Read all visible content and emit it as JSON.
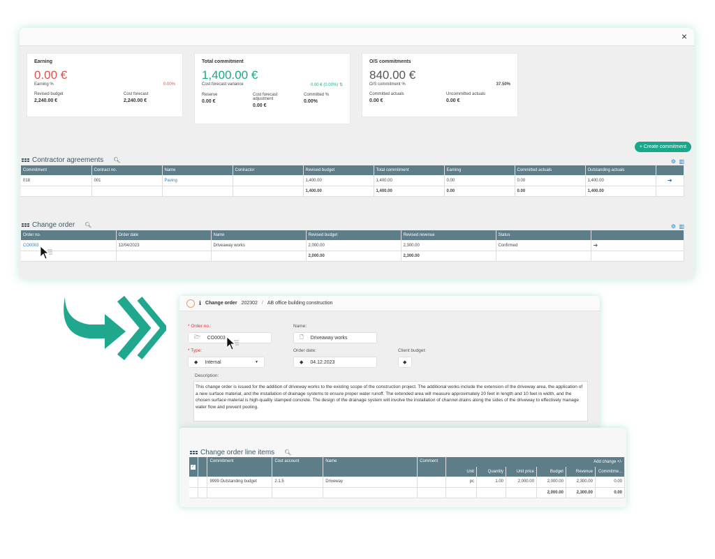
{
  "panel": {
    "close": "×",
    "cards": {
      "earning": {
        "title": "Earning",
        "value": "0.00 €",
        "pct_label": "Earning %",
        "pct": "0.00%",
        "revised_budget_label": "Revised budget",
        "revised_budget": "2,240.00 €",
        "cost_forecast_label": "Cost forecast",
        "cost_forecast": "2,240.00 €"
      },
      "total_commitment": {
        "title": "Total commitment",
        "value": "1,400.00 €",
        "variance_label": "Cost forecast variance",
        "variance": "0.00 € (0.00%) ⇅",
        "reserve_label": "Reserve",
        "reserve": "0.00 €",
        "adj_label_1": "Cost forecast",
        "adj_label_2": "adjustment",
        "adj": "0.00 €",
        "committed_pct_label": "Committed %",
        "committed_pct": "0.00%"
      },
      "os": {
        "title": "O/S commitments",
        "value": "840.00 €",
        "pct_label": "O/S commitment %",
        "pct": "37.50%",
        "committed_actuals_label": "Committed actuals",
        "committed_actuals": "0.00 €",
        "uncommitted_label": "Uncommitted actuals",
        "uncommitted": "0.00 €"
      }
    },
    "create_button": "+ Create commitment",
    "contractor": {
      "title": "Contractor agreements",
      "headers": [
        "Commitment",
        "Contract no.",
        "Name",
        "Contractor",
        "Revised budget",
        "Total commitment",
        "Earning",
        "Committed actuals",
        "Outstanding actuals"
      ],
      "row": [
        "018",
        "001",
        "Paving",
        "",
        "1,400.00",
        "1,400.00",
        "0.00",
        "0.00",
        "1,400.00"
      ],
      "totals": [
        "",
        "",
        "",
        "",
        "1,400.00",
        "1,400.00",
        "0.00",
        "0.00",
        "1,400.00"
      ]
    },
    "change_order": {
      "title": "Change order",
      "headers": [
        "Order no.",
        "Order date",
        "Name",
        "Revised budget",
        "Revised revenue",
        "Status"
      ],
      "row": [
        "CO0003",
        "12/04/2023",
        "Driveaway works",
        "2,000.00",
        "2,300.00",
        "Confirmed"
      ],
      "totals": [
        "",
        "",
        "",
        "2,000.00",
        "2,300.00",
        ""
      ]
    }
  },
  "form": {
    "header": {
      "title": "Change order",
      "number": "202302",
      "sep": "/",
      "project": "AB office building construction"
    },
    "order_no_label": "Order no.:",
    "order_no": "CO0003",
    "name_label": "Name:",
    "name": "Driveaway works",
    "type_label": "Type:",
    "type": "Internal",
    "order_date_label": "Order date:",
    "order_date": "04.12.2023",
    "client_budget_label": "Client budget:",
    "description_label": "Description:",
    "description": "This change order is issued for the addition of driveway works to the existing scope of the construction project. The additional works include the extension of the driveway area, the application of a new surface material, and the installation of drainage systems to ensure proper water runoff. The extended area will measure approximately 20 feet in length and 10 feet in width, and the chosen surface material is high-quality stamped concrete. The design of the drainage system will involve the installation of channel drains along the sides of the driveway to effectively manage water flow and prevent pooling."
  },
  "lines": {
    "title": "Change order line items",
    "headers": [
      "Commitment",
      "Cost account",
      "Name",
      "Comment"
    ],
    "add_change": "Add change +/-",
    "sub_headers": [
      "Unit",
      "Quantity",
      "Unit price",
      "Budget",
      "Revenue",
      "Commitme..."
    ],
    "row": [
      "9999 Outstanding budget",
      "2.1.5",
      "Driveway",
      "",
      "pc",
      "1.00",
      "2,000.00",
      "2,000.00",
      "2,300.00",
      "0.00"
    ],
    "totals": [
      "2,000.00",
      "2,300.00",
      "0.00"
    ]
  },
  "colors": {
    "accent": "#1aa88a",
    "header": "#5d7d88",
    "link": "#2a7fc1",
    "negative": "#d9534f"
  }
}
